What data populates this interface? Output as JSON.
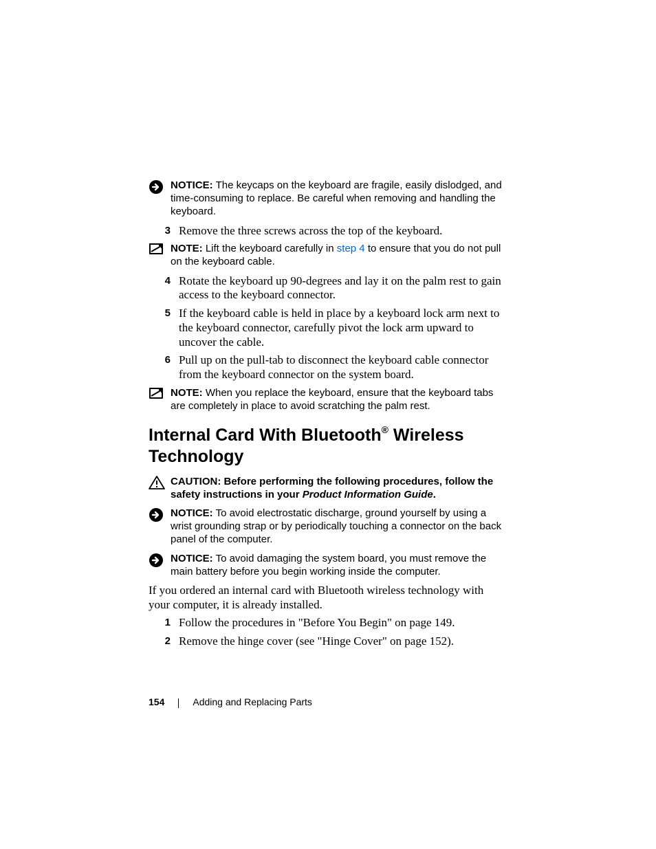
{
  "notice1": {
    "lead": "NOTICE:",
    "text": " The keycaps on the keyboard are fragile, easily dislodged, and time-consuming to replace. Be careful when removing and handling the keyboard."
  },
  "step3": {
    "num": "3",
    "text": "Remove the three screws across the top of the keyboard."
  },
  "note1": {
    "lead": "NOTE:",
    "pre": " Lift the keyboard carefully in ",
    "link": "step 4",
    "post": " to ensure that you do not pull on the keyboard cable."
  },
  "step4": {
    "num": "4",
    "text": "Rotate the keyboard up 90-degrees and lay it on the palm rest to gain access to the keyboard connector."
  },
  "step5": {
    "num": "5",
    "text": "If the keyboard cable is held in place by a keyboard lock arm next to the keyboard connector, carefully pivot the lock arm upward to uncover the cable."
  },
  "step6": {
    "num": "6",
    "text": "Pull up on the pull-tab to disconnect the keyboard cable connector from the keyboard connector on the system board."
  },
  "note2": {
    "lead": "NOTE:",
    "text": " When you replace the keyboard, ensure that the keyboard tabs are completely in place to avoid scratching the palm rest."
  },
  "heading": {
    "pre": "Internal Card With Bluetooth",
    "reg": "®",
    "post": " Wireless Technology"
  },
  "caution": {
    "lead": "CAUTION: ",
    "text": "Before performing the following procedures, follow the safety instructions in your ",
    "ital": "Product Information Guide",
    "tail": "."
  },
  "notice2": {
    "lead": "NOTICE:",
    "text": " To avoid electrostatic discharge, ground yourself by using a wrist grounding strap or by periodically touching a connector on the back panel of the computer."
  },
  "notice3": {
    "lead": "NOTICE:",
    "text": " To avoid damaging the system board, you must remove the main battery before you begin working inside the computer."
  },
  "para1": "If you ordered an internal card with Bluetooth wireless technology with your computer, it is already installed.",
  "bstep1": {
    "num": "1",
    "text": "Follow the procedures in \"Before You Begin\" on page 149."
  },
  "bstep2": {
    "num": "2",
    "text": "Remove the hinge cover (see \"Hinge Cover\" on page 152)."
  },
  "footer": {
    "page": "154",
    "section": "Adding and Replacing Parts"
  }
}
